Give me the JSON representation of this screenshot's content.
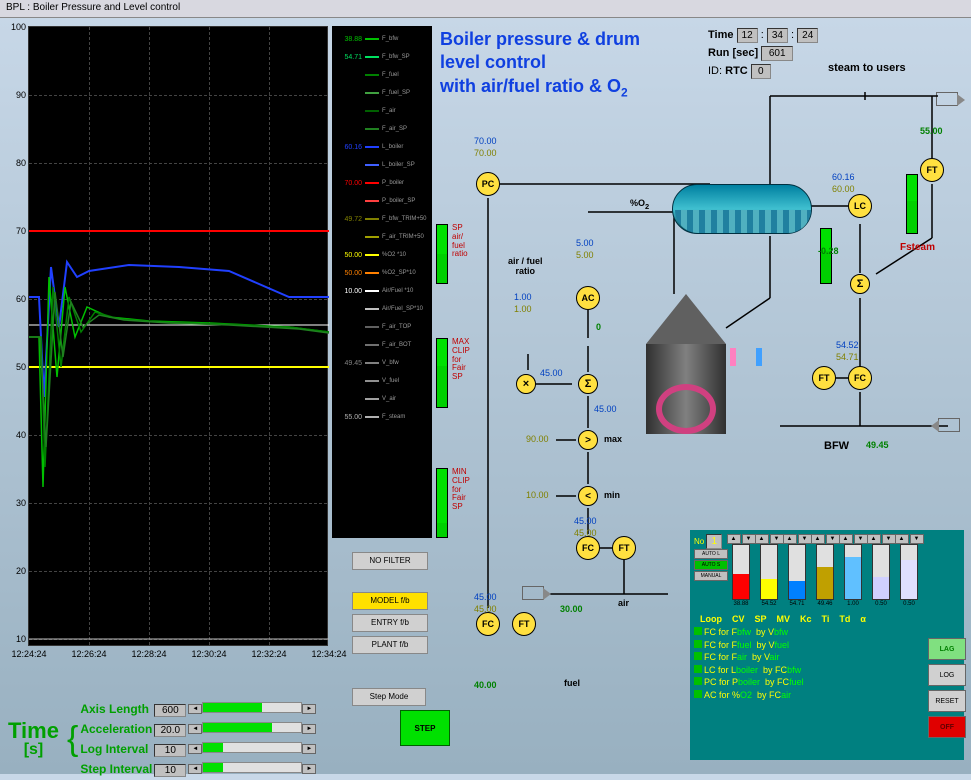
{
  "window_title": "BPL : Boiler Pressure and Level control",
  "app_title_line1": "Boiler pressure & drum",
  "app_title_line2": "level control",
  "app_title_line3": "with air/fuel ratio & O",
  "app_title_sub": "2",
  "status": {
    "time_label": "Time",
    "time_hh": "12",
    "time_mm": "34",
    "time_ss": "24",
    "run_label": "Run",
    "run_unit": "[sec]",
    "run_val": "601",
    "id_label": "ID:",
    "id_name": "RTC",
    "id_val": "0"
  },
  "chart": {
    "y_ticks": [
      "100",
      "90",
      "80",
      "70",
      "60",
      "50",
      "40",
      "30",
      "20",
      "10"
    ],
    "x_ticks": [
      "12:24:24",
      "12:26:24",
      "12:28:24",
      "12:30:24",
      "12:32:24",
      "12:34:24"
    ]
  },
  "legend": [
    {
      "val": "38.88",
      "name": "F_bfw",
      "color": "#00c000"
    },
    {
      "val": "54.71",
      "name": "F_bfw_SP",
      "color": "#00e060"
    },
    {
      "val": "",
      "name": "F_fuel",
      "color": "#008000"
    },
    {
      "val": "",
      "name": "F_fuel_SP",
      "color": "#40a040"
    },
    {
      "val": "",
      "name": "F_air",
      "color": "#006000"
    },
    {
      "val": "",
      "name": "F_air_SP",
      "color": "#208020"
    },
    {
      "val": "60.16",
      "name": "L_boiler",
      "color": "#2040ff"
    },
    {
      "val": "",
      "name": "L_boiler_SP",
      "color": "#4060ff"
    },
    {
      "val": "70.00",
      "name": "P_boiler",
      "color": "#ff0000"
    },
    {
      "val": "",
      "name": "P_boiler_SP",
      "color": "#ff4040"
    },
    {
      "val": "49.72",
      "name": "F_bfw_TRIM+50",
      "color": "#808000"
    },
    {
      "val": "",
      "name": "F_air_TRIM+50",
      "color": "#a0a000"
    },
    {
      "val": "50.00",
      "name": "%O2 *10",
      "color": "#ffff00"
    },
    {
      "val": "50.00",
      "name": "%O2_SP*10",
      "color": "#ff8000"
    },
    {
      "val": "10.00",
      "name": "Air/Fuel *10",
      "color": "#ffffff"
    },
    {
      "val": "",
      "name": "Air/Fuel_SP*10",
      "color": "#c0c0c0"
    },
    {
      "val": "",
      "name": "F_air_TOP",
      "color": "#606060"
    },
    {
      "val": "",
      "name": "F_air_BOT",
      "color": "#707070"
    },
    {
      "val": "49.45",
      "name": "V_bfw",
      "color": "#808080"
    },
    {
      "val": "",
      "name": "V_fuel",
      "color": "#909090"
    },
    {
      "val": "",
      "name": "V_air",
      "color": "#a0a0a0"
    },
    {
      "val": "55.00",
      "name": "F_steam",
      "color": "#b0b0b0"
    }
  ],
  "bars": {
    "sp_label": "SP\nair/\nfuel\nratio",
    "max_label": "MAX\nCLIP\nfor\nFair\nSP",
    "min_label": "MIN\nCLIP\nfor\nFair\nSP"
  },
  "pfd": {
    "steam_users": "steam to users",
    "pc": {
      "pv": "70.00",
      "sp": "70.00",
      "tag": "PC"
    },
    "ft_steam": {
      "val": "55.00",
      "tag": "FT"
    },
    "lc": {
      "pv": "60.16",
      "sp": "60.00",
      "tag": "LC",
      "out": "-0.28"
    },
    "fsteam_label": "Fsteam",
    "sigma": "Σ",
    "ft_bfw": {
      "pv": "54.52",
      "sp": "54.71",
      "tag": "FT"
    },
    "fc_bfw": {
      "tag": "FC"
    },
    "bfw_label": "BFW",
    "bfw_valve": "49.45",
    "o2_label": "%O",
    "o2_sub": "2",
    "ac": {
      "pv": "5.00",
      "sp": "5.00",
      "tag": "AC",
      "out": "0"
    },
    "afr_label": "air / fuel\nratio",
    "afr": {
      "pv": "1.00",
      "sp": "1.00"
    },
    "mult": "×",
    "mult_val": "45.00",
    "sum_val": "45.00",
    "max_label": "max",
    "max_left": "90.00",
    "min_label": "min",
    "min_left": "10.00",
    "fc_air": {
      "pv": "45.00",
      "sp": "45.00",
      "tag": "FC"
    },
    "ft_air": {
      "tag": "FT"
    },
    "air_label": "air",
    "air_valve": "30.00",
    "fc_fuel": {
      "pv": "45.00",
      "sp": "45.00",
      "tag": "FC"
    },
    "ft_fuel": {
      "tag": "FT"
    },
    "fuel_label": "fuel",
    "fuel_valve": "40.00"
  },
  "buttons": {
    "nofilter": "NO FILTER",
    "modelfb": "MODEL f/b",
    "entryfb": "ENTRY f/b",
    "plantfb": "PLANT f/b",
    "stepmode": "Step Mode",
    "step": "STEP"
  },
  "time_panel": {
    "title": "Time",
    "unit": "[s]",
    "rows": [
      {
        "label": "Axis Length",
        "val": "600"
      },
      {
        "label": "Acceleration",
        "val": "20.0"
      },
      {
        "label": "Log Interval",
        "val": "10"
      },
      {
        "label": "Step Interval",
        "val": "10"
      }
    ]
  },
  "tuning": {
    "no_label": "No",
    "no_val": "1",
    "auto_l": "AUTO L",
    "auto_s": "AUTO S",
    "manual": "MANUAL",
    "bar_labels": [
      "CV",
      "SP",
      "MV",
      "Kc",
      "Ti",
      "Td",
      "α"
    ],
    "bar_vals": [
      "38.88",
      "54.52",
      "54.71",
      "49.46",
      "1.00",
      "0.50",
      "0.50"
    ],
    "bar_colors": [
      "#ff0000",
      "#ffff00",
      "#0080ff",
      "#c0a000",
      "#60c0ff",
      "#d0d0ff",
      "#e0e0ff"
    ],
    "header": [
      "Loop",
      "CV",
      "SP",
      "MV",
      "Kc",
      "Ti",
      "Td",
      "α"
    ],
    "loops": [
      {
        "tag": "FC for F",
        "cv": "bfw",
        "by": "by V",
        "mv": "bfw"
      },
      {
        "tag": "FC for F",
        "cv": "fuel",
        "by": "by V",
        "mv": "fuel"
      },
      {
        "tag": "FC for F",
        "cv": "air",
        "by": "by V",
        "mv": "air"
      },
      {
        "tag": "LC for L",
        "cv": "boiler",
        "by": "by FC",
        "mv": "bfw"
      },
      {
        "tag": "PC for P",
        "cv": "boiler",
        "by": "by FC",
        "mv": "fuel"
      },
      {
        "tag": "AC for %",
        "cv": "O2",
        "by": "by FC",
        "mv": "air"
      }
    ]
  },
  "rbtns": {
    "lag": "LAG",
    "log": "LOG",
    "reset": "RESET",
    "off": "OFF"
  }
}
